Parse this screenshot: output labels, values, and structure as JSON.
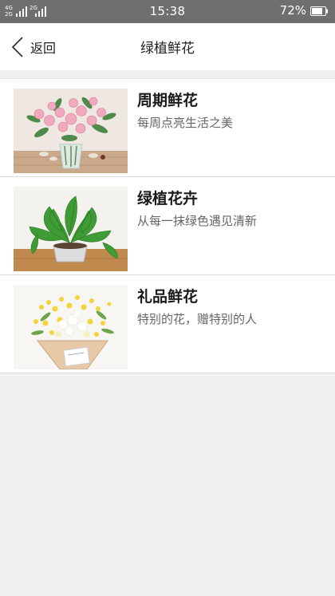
{
  "status_bar": {
    "network_top": "4G",
    "network_bottom": "2G",
    "network_second": "2G",
    "time": "15:38",
    "battery_percent": "72%"
  },
  "nav": {
    "back_label": "返回",
    "title": "绿植鲜花"
  },
  "items": [
    {
      "title": "周期鲜花",
      "subtitle": "每周点亮生活之美",
      "image": "pink-roses-vase"
    },
    {
      "title": "绿植花卉",
      "subtitle": "从每一抹绿色遇见清新",
      "image": "potted-green-plant"
    },
    {
      "title": "礼品鲜花",
      "subtitle": "特别的花，赠特别的人",
      "image": "yellow-flower-bouquet"
    }
  ],
  "colors": {
    "status_bar": "#6f6f6f",
    "page_background": "#f0f0f0",
    "card_background": "#ffffff",
    "title_text": "#1a1a1a",
    "subtitle_text": "#666666"
  }
}
